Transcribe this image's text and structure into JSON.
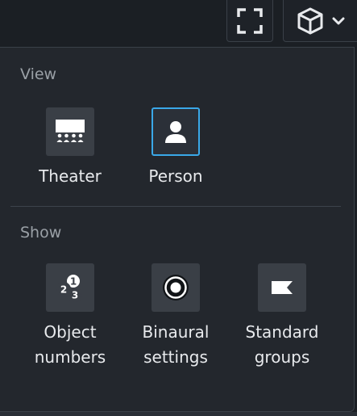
{
  "toolbar": {
    "fullscreen_icon": "fullscreen-icon",
    "view_mode_icon": "cube-icon",
    "dropdown_icon": "chevron-down-icon"
  },
  "view_section": {
    "title": "View",
    "options": [
      {
        "label": "Theater",
        "icon": "theater-icon",
        "selected": false
      },
      {
        "label": "Person",
        "icon": "person-icon",
        "selected": true
      }
    ]
  },
  "show_section": {
    "title": "Show",
    "options": [
      {
        "label": "Object\nnumbers",
        "icon": "object-numbers-icon"
      },
      {
        "label": "Binaural\nsettings",
        "icon": "binaural-icon"
      },
      {
        "label": "Standard\ngroups",
        "icon": "standard-groups-icon"
      }
    ]
  },
  "colors": {
    "accent": "#3aa8e8",
    "panel_bg": "#23272d",
    "tile_bg": "#3a3f46"
  }
}
